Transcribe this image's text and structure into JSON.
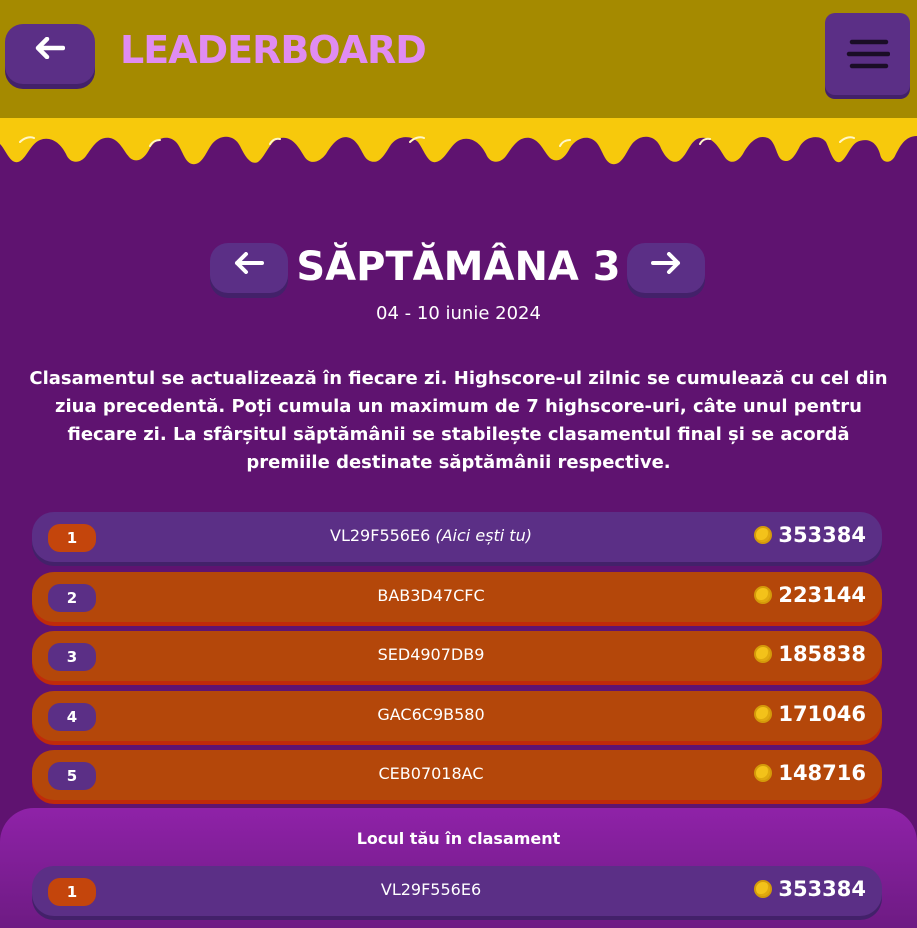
{
  "header": {
    "title": "LEADERBOARD",
    "back_icon": "arrow-left-icon",
    "menu_icon": "hamburger-menu-icon",
    "bg_color": "#a58a00",
    "title_color": "#e08cf2"
  },
  "week": {
    "title": "SĂPTĂMÂNA 3",
    "dates": "04 - 10 iunie 2024",
    "prev_icon": "arrow-left-icon",
    "next_icon": "arrow-right-icon"
  },
  "info_text": "Clasamentul se actualizează în fiecare zi. Highscore-ul zilnic se cumulează cu cel din ziua precedentă. Poți cumula un maximum de 7 highscore-uri, câte unul pentru fiecare zi. La sfârșitul săptămânii se stabilește clasamentul final și se acordă premiile destinate săptămânii respective.",
  "leaderboard": [
    {
      "rank": "1",
      "name": "VL29F556E6",
      "note": "(Aici ești tu)",
      "score": "353384"
    },
    {
      "rank": "2",
      "name": "BAB3D47CFC",
      "score": "223144"
    },
    {
      "rank": "3",
      "name": "SED4907DB9",
      "score": "185838"
    },
    {
      "rank": "4",
      "name": "GAC6C9B580",
      "score": "171046"
    },
    {
      "rank": "5",
      "name": "CEB07018AC",
      "score": "148716"
    }
  ],
  "my_position": {
    "title": "Locul tău în clasament",
    "rank": "1",
    "name": "VL29F556E6",
    "score": "353384"
  },
  "colors": {
    "background": "#5f1370",
    "drip": "#f7c90c",
    "you_row": "#5b2f86",
    "other_row": "#b4470a",
    "coin": "#f3c21a"
  }
}
